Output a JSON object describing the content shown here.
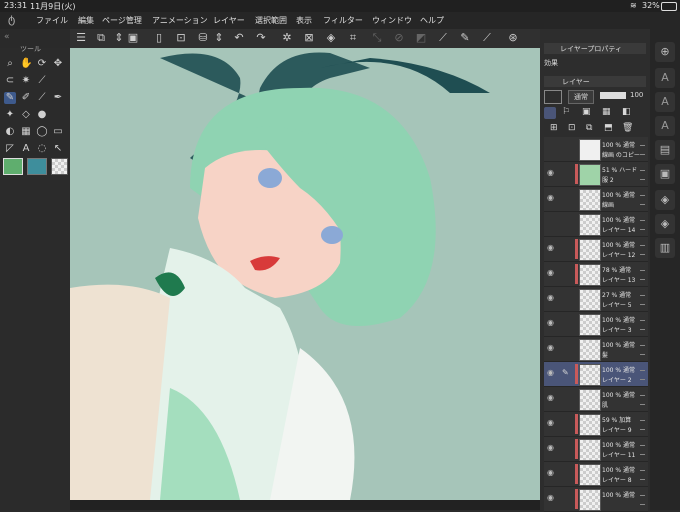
{
  "status": {
    "time": "23:31",
    "date": "11月9日(火)",
    "battery": "32%"
  },
  "menu": [
    "ファイル",
    "編集",
    "ページ管理",
    "アニメーション",
    "レイヤー",
    "選択範囲",
    "表示",
    "フィルター",
    "ウィンドウ",
    "ヘルプ"
  ],
  "toolpanel": {
    "title": "ツール"
  },
  "layerprops": {
    "title": "レイヤープロパティ",
    "effect_label": "効果"
  },
  "layers": {
    "title": "レイヤー",
    "blend_mode": "通常",
    "opacity": "100",
    "items": [
      {
        "line1": "100 % 通常",
        "line2": "線画 のコピー",
        "thumb": "white",
        "visible": false,
        "red": false
      },
      {
        "line1": "51 % ハード",
        "line2": "服 2",
        "thumb": "green",
        "visible": true,
        "red": true
      },
      {
        "line1": "100 % 通常",
        "line2": "線画",
        "thumb": "checker",
        "visible": true,
        "red": false
      },
      {
        "line1": "100 % 通常",
        "line2": "レイヤー 14",
        "thumb": "checker",
        "visible": false,
        "red": false
      },
      {
        "line1": "100 % 通常",
        "line2": "レイヤー 12",
        "thumb": "checker",
        "visible": true,
        "red": true
      },
      {
        "line1": "78 % 通常",
        "line2": "レイヤー 13",
        "thumb": "checker",
        "visible": true,
        "red": true
      },
      {
        "line1": "27 % 通常",
        "line2": "レイヤー 5",
        "thumb": "checker",
        "visible": true,
        "red": false
      },
      {
        "line1": "100 % 通常",
        "line2": "レイヤー 3",
        "thumb": "checker",
        "visible": true,
        "red": false
      },
      {
        "line1": "100 % 通常",
        "line2": "髪",
        "thumb": "checker",
        "visible": true,
        "red": false
      },
      {
        "line1": "100 % 通常",
        "line2": "レイヤー 2",
        "thumb": "checker",
        "visible": true,
        "red": true,
        "selected": true
      },
      {
        "line1": "100 % 通常",
        "line2": "肌",
        "thumb": "checker",
        "visible": true,
        "red": false
      },
      {
        "line1": "59 % 加算",
        "line2": "レイヤー 9",
        "thumb": "checker",
        "visible": true,
        "red": true
      },
      {
        "line1": "100 % 通常",
        "line2": "レイヤー 11",
        "thumb": "checker",
        "visible": true,
        "red": true
      },
      {
        "line1": "100 % 通常",
        "line2": "レイヤー 8",
        "thumb": "checker",
        "visible": true,
        "red": true
      },
      {
        "line1": "100 % 通常",
        "line2": "",
        "thumb": "checker",
        "visible": true,
        "red": true
      }
    ]
  },
  "colors": {
    "main": "#5fae6e",
    "sub": "#3e8e9c",
    "canvas_bg": "#a6c5b9",
    "hair": "#8fd3b2",
    "selected_layer": "#4a5578"
  }
}
